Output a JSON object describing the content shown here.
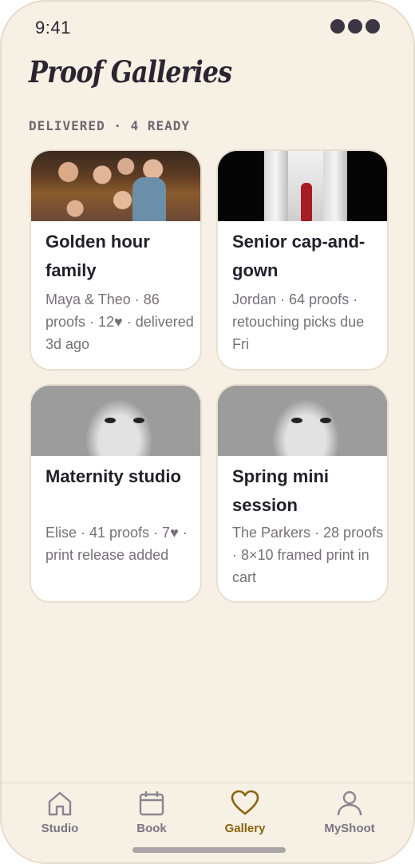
{
  "status": {
    "time": "9:41"
  },
  "header": {
    "title": "Proof Galleries"
  },
  "section": {
    "label": "DELIVERED · 4 READY"
  },
  "galleries": [
    {
      "title": "Golden hour family",
      "meta": "Maya & Theo · 86 proofs · 12♥ · delivered 3d ago",
      "thumbnail": "family-photo"
    },
    {
      "title": "Senior cap-and-gown",
      "meta": "Jordan · 64 proofs · retouching picks due Fri",
      "thumbnail": "graduate-photo"
    },
    {
      "title": "Maternity studio",
      "meta": "Elise · 41 proofs · 7♥ · print release added",
      "thumbnail": "girl-portrait"
    },
    {
      "title": "Spring mini session",
      "meta": "The Parkers · 28 proofs · 8×10 framed print in cart",
      "thumbnail": "girl-portrait"
    }
  ],
  "tabbar": {
    "active": "Gallery",
    "items": [
      {
        "label": "Studio",
        "icon": "home-icon"
      },
      {
        "label": "Book",
        "icon": "calendar-icon"
      },
      {
        "label": "Gallery",
        "icon": "heart-icon"
      },
      {
        "label": "MyShoot",
        "icon": "user-icon"
      }
    ]
  },
  "colors": {
    "background": "#f7f0e4",
    "accent": "#8a6410",
    "text": "#231f29",
    "muted": "#777078"
  }
}
